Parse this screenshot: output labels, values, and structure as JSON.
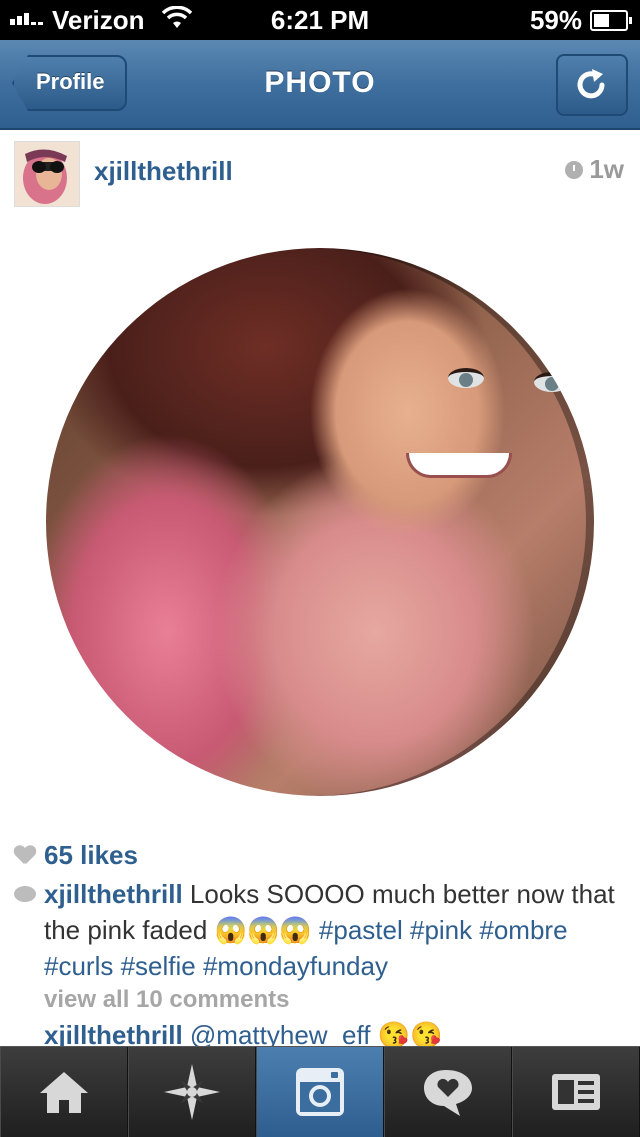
{
  "status_bar": {
    "carrier": "Verizon",
    "time": "6:21 PM",
    "battery": "59%",
    "battery_level": 0.59,
    "signal_bars": 5,
    "icons": [
      "signal-icon",
      "wifi-icon",
      "battery-icon"
    ]
  },
  "navbar": {
    "back_label": "Profile",
    "title": "PHOTO",
    "refresh_icon": "refresh-icon"
  },
  "post": {
    "username": "xjillthethrill",
    "timestamp": "1w",
    "likes": "65 likes",
    "caption": {
      "author": "xjillthethrill",
      "text": " Looks SOOOO much better now that the pink faded ",
      "emoji": "😱😱😱",
      "hashtags": " #pastel #pink #ombre #curls #selfie #mondayfunday"
    },
    "view_all": "view all 10 comments",
    "comment": {
      "author": "xjillthethrill",
      "text": " @mattyhew_eff ",
      "emoji": "😘😘"
    }
  },
  "tabbar": {
    "tabs": [
      {
        "icon": "home-icon",
        "active": false
      },
      {
        "icon": "explore-icon",
        "active": false
      },
      {
        "icon": "camera-icon",
        "active": true
      },
      {
        "icon": "activity-icon",
        "active": false
      },
      {
        "icon": "profile-icon",
        "active": false
      }
    ]
  },
  "colors": {
    "accent": "#2f5f8f",
    "navbar": "#3f6f9e",
    "tab_active": "#3c6d9f",
    "muted": "#a6a6a6"
  }
}
